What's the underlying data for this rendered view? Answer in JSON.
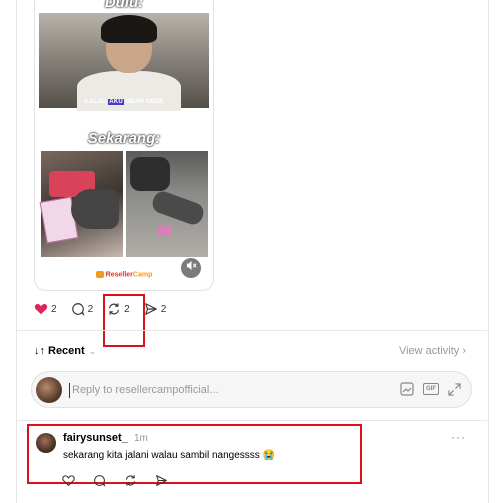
{
  "media": {
    "caption_top": "Dulu:",
    "subtitle_before": "KALAU ",
    "subtitle_highlight": "AKU",
    "subtitle_after": " UDAH GEDE",
    "caption_mid": "Sekarang:",
    "brand_primary": "Reseller",
    "brand_secondary": "Camp",
    "mute_icon": "speaker-muted-icon"
  },
  "actions": {
    "like_count": "2",
    "comment_count": "2",
    "repost_count": "2",
    "share_count": "2",
    "like_color": "#e0245e"
  },
  "sort": {
    "arrows": "↓↑",
    "label": "Recent",
    "chevron": "⌄",
    "view_activity": "View activity ›"
  },
  "reply": {
    "placeholder": "Reply to resellercampofficial...",
    "gif_label": "GIF"
  },
  "comment": {
    "username": "fairysunset_",
    "time": "1m",
    "more": "···",
    "text": "sekarang kita jalani walau sambil nangessss 😭"
  },
  "colors": {
    "annotation_red": "#d8121c",
    "accent_orange": "#f29a1f"
  }
}
